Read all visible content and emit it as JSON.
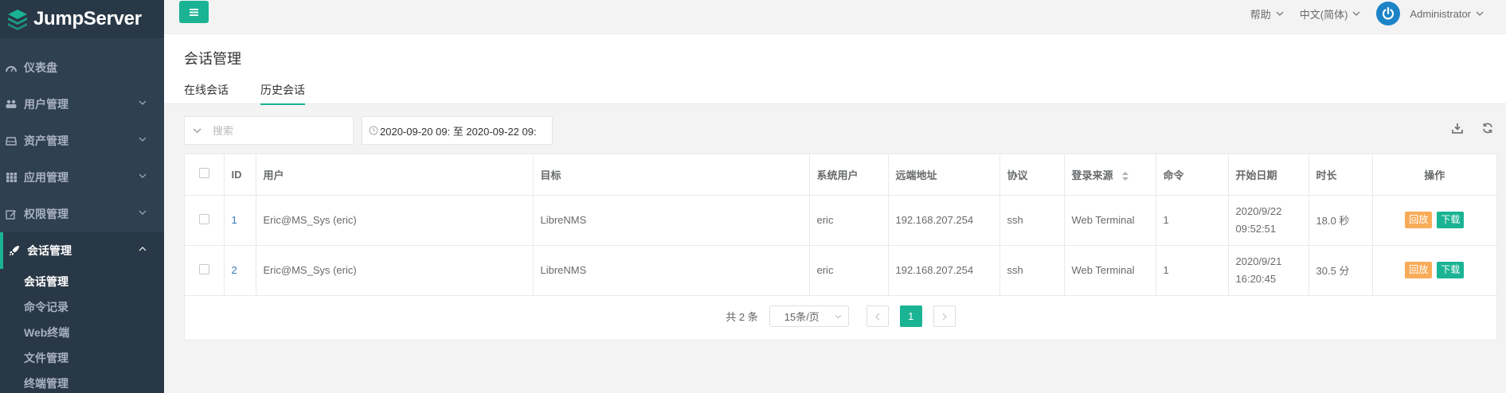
{
  "brand": {
    "name": "JumpServer"
  },
  "sidebar": {
    "items": [
      {
        "label": "仪表盘",
        "icon": "dashboard-icon"
      },
      {
        "label": "用户管理",
        "icon": "users-icon"
      },
      {
        "label": "资产管理",
        "icon": "inbox-icon"
      },
      {
        "label": "应用管理",
        "icon": "grid-icon"
      },
      {
        "label": "权限管理",
        "icon": "edit-icon"
      },
      {
        "label": "会话管理",
        "icon": "rocket-icon"
      }
    ],
    "sub_items": [
      "会话管理",
      "命令记录",
      "Web终端",
      "文件管理",
      "终端管理"
    ]
  },
  "topbar": {
    "help": "帮助",
    "language": "中文(简体)",
    "user": "Administrator"
  },
  "page": {
    "title": "会话管理",
    "tabs": [
      "在线会话",
      "历史会话"
    ]
  },
  "toolbar": {
    "search_placeholder": "搜索",
    "date_range": "2020-09-20 09: 至 2020-09-22 09:"
  },
  "table": {
    "headers": [
      "ID",
      "用户",
      "目标",
      "系统用户",
      "远端地址",
      "协议",
      "登录来源",
      "命令",
      "开始日期",
      "时长",
      "操作"
    ],
    "rows": [
      {
        "id": "1",
        "user": "Eric@MS_Sys (eric)",
        "target": "LibreNMS",
        "system_user": "eric",
        "remote_addr": "192.168.207.254",
        "protocol": "ssh",
        "login_from": "Web Terminal",
        "commands": "1",
        "date_line1": "2020/9/22",
        "date_line2": "09:52:51",
        "duration": "18.0 秒",
        "replay": "回放",
        "download": "下载"
      },
      {
        "id": "2",
        "user": "Eric@MS_Sys (eric)",
        "target": "LibreNMS",
        "system_user": "eric",
        "remote_addr": "192.168.207.254",
        "protocol": "ssh",
        "login_from": "Web Terminal",
        "commands": "1",
        "date_line1": "2020/9/21",
        "date_line2": "16:20:45",
        "duration": "30.5 分",
        "replay": "回放",
        "download": "下载"
      }
    ]
  },
  "pagination": {
    "total": "共 2 条",
    "page_size": "15条/页",
    "current": "1"
  },
  "colors": {
    "accent": "#1ab394",
    "sidebar": "#2f4050",
    "warning": "#f8ac59",
    "avatar": "#1c84c6"
  }
}
